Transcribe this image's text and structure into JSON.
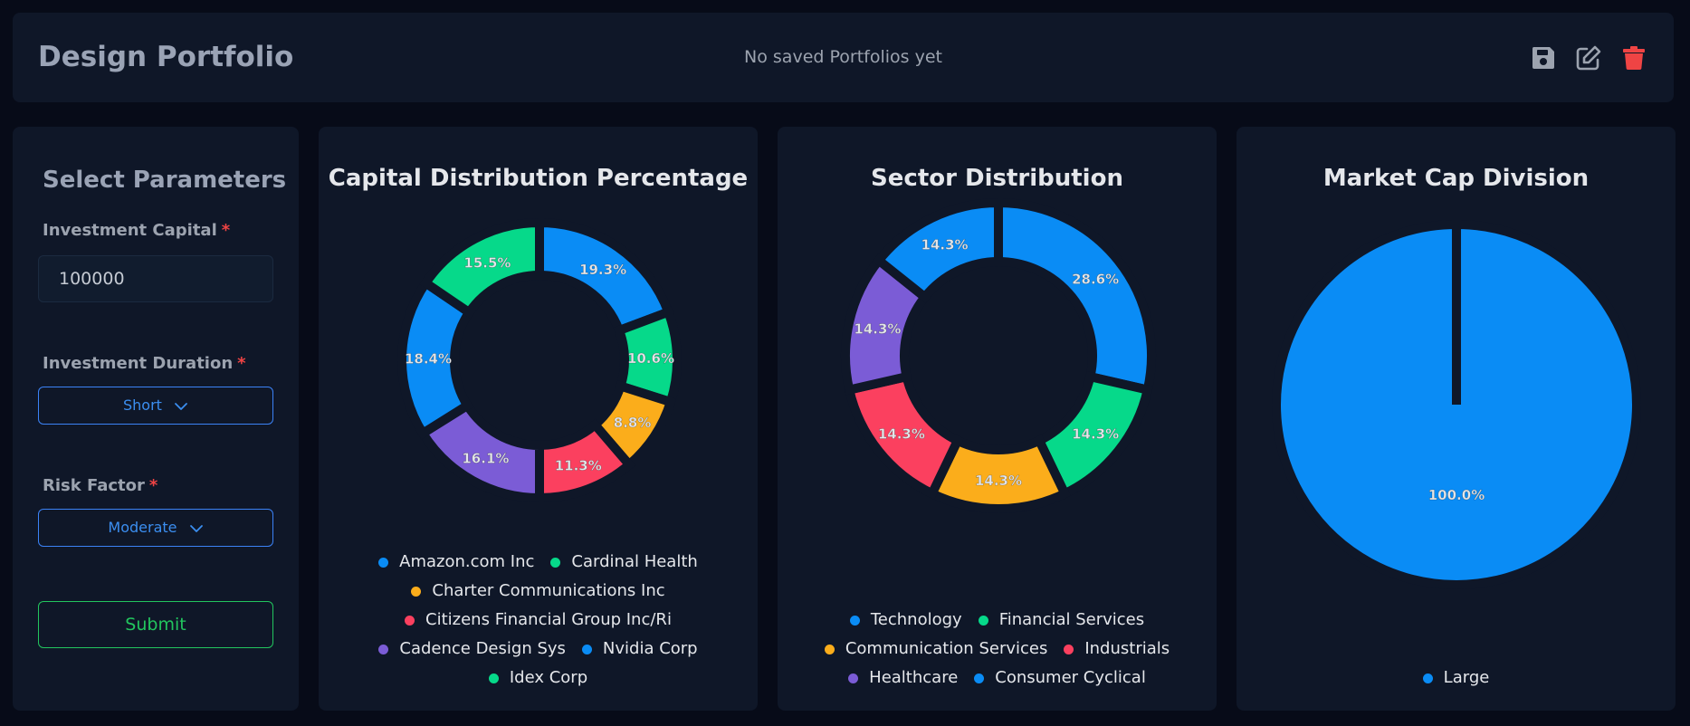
{
  "header": {
    "title": "Design Portfolio",
    "status_text": "No saved Portfolios yet",
    "icons": {
      "save": "save-icon",
      "edit": "edit-icon",
      "delete": "trash-icon"
    },
    "colors": {
      "icon": "#9ca3af",
      "delete": "#ef4444"
    }
  },
  "params": {
    "title": "Select Parameters",
    "required_mark": "*",
    "capital_label": "Investment Capital",
    "capital_value": "100000",
    "duration_label": "Investment Duration",
    "duration_value": "Short",
    "risk_label": "Risk Factor",
    "risk_value": "Moderate",
    "submit_label": "Submit"
  },
  "colors": {
    "blue": "#0a8cf5",
    "green": "#06d98a",
    "yellow": "#fbad1b",
    "red": "#fb405f",
    "purple": "#7b5cd6"
  },
  "chart_data": [
    {
      "type": "pie",
      "variant": "donut",
      "title": "Capital Distribution Percentage",
      "categories": [
        "Amazon.com Inc",
        "Cardinal Health",
        "Charter Communications Inc",
        "Citizens Financial Group Inc/Ri",
        "Cadence Design Sys",
        "Nvidia Corp",
        "Idex Corp"
      ],
      "values": [
        19.3,
        10.6,
        8.8,
        11.3,
        16.1,
        18.4,
        15.5
      ],
      "labels": [
        "19.3%",
        "10.6%",
        "8.8%",
        "11.3%",
        "16.1%",
        "18.4%",
        "15.5%"
      ],
      "colors": [
        "#0a8cf5",
        "#06d98a",
        "#fbad1b",
        "#fb405f",
        "#7b5cd6",
        "#0a8cf5",
        "#06d98a"
      ],
      "legend_rows": [
        2,
        1,
        1,
        3
      ],
      "legend": "bottom"
    },
    {
      "type": "pie",
      "variant": "donut",
      "title": "Sector Distribution",
      "categories": [
        "Technology",
        "Financial Services",
        "Communication Services",
        "Industrials",
        "Healthcare",
        "Consumer Cyclical"
      ],
      "values": [
        28.6,
        14.3,
        14.3,
        14.3,
        14.3,
        14.3
      ],
      "labels": [
        "28.6%",
        "14.3%",
        "14.3%",
        "14.3%",
        "14.3%",
        "14.3%"
      ],
      "colors": [
        "#0a8cf5",
        "#06d98a",
        "#fbad1b",
        "#fb405f",
        "#7b5cd6",
        "#0a8cf5"
      ],
      "legend_rows": [
        2,
        2,
        2
      ],
      "legend": "bottom"
    },
    {
      "type": "pie",
      "variant": "pie",
      "title": "Market Cap Division",
      "categories": [
        "Large"
      ],
      "values": [
        100.0
      ],
      "labels": [
        "100.0%"
      ],
      "colors": [
        "#0a8cf5"
      ],
      "legend_rows": [
        1
      ],
      "legend": "bottom"
    }
  ]
}
